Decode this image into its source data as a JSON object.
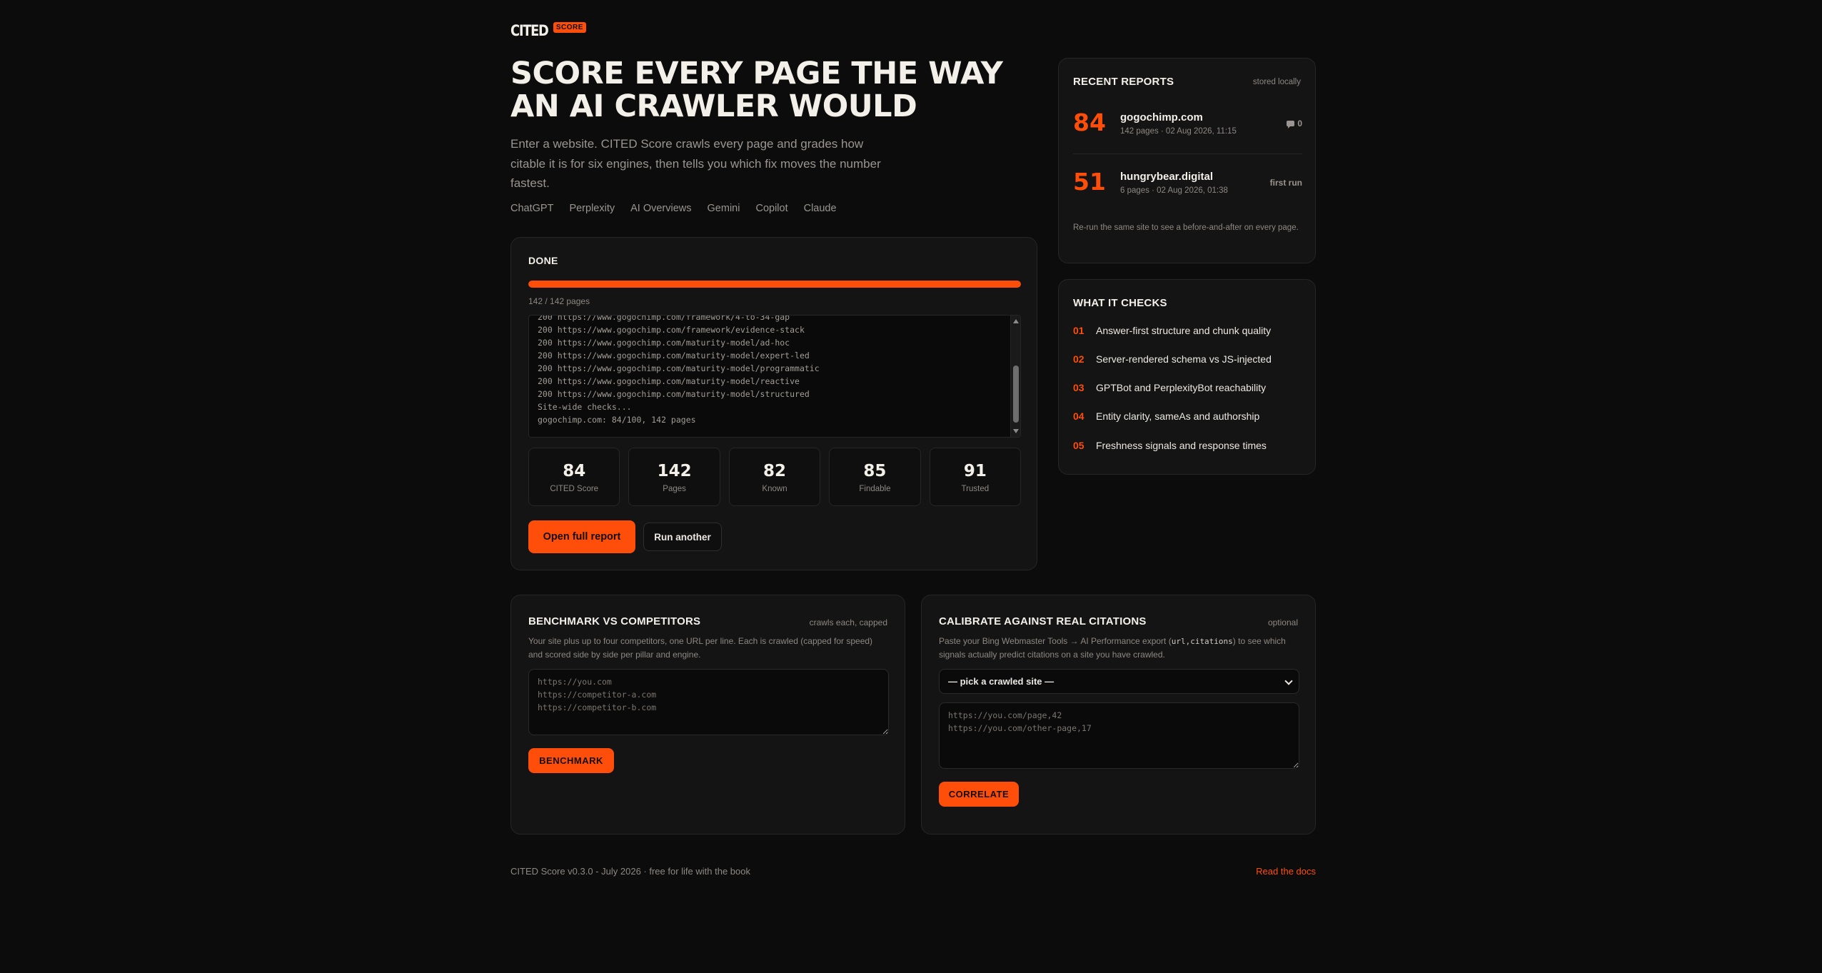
{
  "brand": {
    "word": "CITED",
    "badge": "SCORE"
  },
  "hero": {
    "title": "SCORE EVERY PAGE THE WAY AN AI CRAWLER WOULD",
    "description": "Enter a website. CITED Score crawls every page and grades how citable it is for six engines, then tells you which fix moves the number fastest.",
    "engines": [
      "ChatGPT",
      "Perplexity",
      "AI Overviews",
      "Gemini",
      "Copilot",
      "Claude"
    ]
  },
  "run": {
    "status": "DONE",
    "progress_fraction": 1.0,
    "progress_text": "142 / 142 pages",
    "log": [
      "200 https://www.gogochimp.com/framework/4-to-34-gap",
      "200 https://www.gogochimp.com/framework/evidence-stack",
      "200 https://www.gogochimp.com/maturity-model/ad-hoc",
      "200 https://www.gogochimp.com/maturity-model/expert-led",
      "200 https://www.gogochimp.com/maturity-model/programmatic",
      "200 https://www.gogochimp.com/maturity-model/reactive",
      "200 https://www.gogochimp.com/maturity-model/structured",
      "Site-wide checks...",
      "gogochimp.com: 84/100, 142 pages"
    ],
    "stats": [
      {
        "value": "84",
        "label": "CITED Score"
      },
      {
        "value": "142",
        "label": "Pages"
      },
      {
        "value": "82",
        "label": "Known"
      },
      {
        "value": "85",
        "label": "Findable"
      },
      {
        "value": "91",
        "label": "Trusted"
      }
    ],
    "open_report_label": "Open full report",
    "run_another_label": "Run another"
  },
  "recent": {
    "title": "RECENT REPORTS",
    "hint": "stored locally",
    "reports": [
      {
        "score": "84",
        "domain": "gogochimp.com",
        "meta": "142 pages · 02 Aug 2026, 11:15",
        "right": "0"
      },
      {
        "score": "51",
        "domain": "hungrybear.digital",
        "meta": "6 pages · 02 Aug 2026, 01:38",
        "right": "first run"
      }
    ],
    "note": "Re-run the same site to see a before-and-after on every page."
  },
  "checks": {
    "title": "WHAT IT CHECKS",
    "items": [
      {
        "num": "01",
        "text": "Answer-first structure and chunk quality"
      },
      {
        "num": "02",
        "text": "Server-rendered schema vs JS-injected"
      },
      {
        "num": "03",
        "text": "GPTBot and PerplexityBot reachability"
      },
      {
        "num": "04",
        "text": "Entity clarity, sameAs and authorship"
      },
      {
        "num": "05",
        "text": "Freshness signals and response times"
      }
    ]
  },
  "benchmark": {
    "title": "BENCHMARK VS COMPETITORS",
    "hint": "crawls each, capped",
    "description": "Your site plus up to four competitors, one URL per line. Each is crawled (capped for speed) and scored side by side per pillar and engine.",
    "placeholder": "https://you.com\nhttps://competitor-a.com\nhttps://competitor-b.com",
    "button": "BENCHMARK"
  },
  "calibrate": {
    "title": "CALIBRATE AGAINST REAL CITATIONS",
    "hint": "optional",
    "desc_before": "Paste your Bing Webmaster Tools → AI Performance export (",
    "desc_code": "url,citations",
    "desc_after": ") to see which signals actually predict citations on a site you have crawled.",
    "select_value": "— pick a crawled site —",
    "placeholder": "https://you.com/page,42\nhttps://you.com/other-page,17",
    "button": "CORRELATE"
  },
  "footer": {
    "left": "CITED Score v0.3.0 - July 2026 · free for life with the book",
    "right": "Read the docs"
  },
  "colors": {
    "accent": "#ff4d0a",
    "background": "#0c0c0c",
    "card": "#141414"
  }
}
